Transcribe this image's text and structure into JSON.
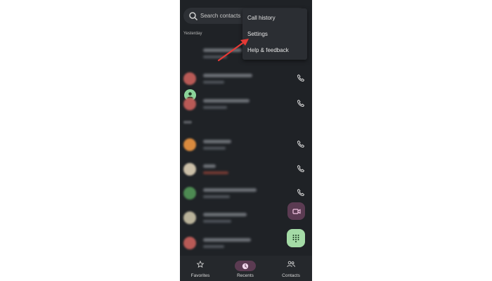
{
  "search": {
    "placeholder": "Search contacts &"
  },
  "sections": {
    "yesterday": "Yesterday"
  },
  "overflow_menu": {
    "items": [
      {
        "label": "Call history"
      },
      {
        "label": "Settings"
      },
      {
        "label": "Help & feedback"
      }
    ]
  },
  "bottom_nav": {
    "items": [
      {
        "label": "Favorites",
        "icon": "star-icon"
      },
      {
        "label": "Recents",
        "icon": "clock-icon",
        "selected": true
      },
      {
        "label": "Contacts",
        "icon": "people-icon"
      }
    ]
  },
  "colors": {
    "background": "#1f2226",
    "accent_pill": "#5b3b52",
    "dialpad_fab": "#a4dba6",
    "annotation_arrow": "#e53935"
  }
}
